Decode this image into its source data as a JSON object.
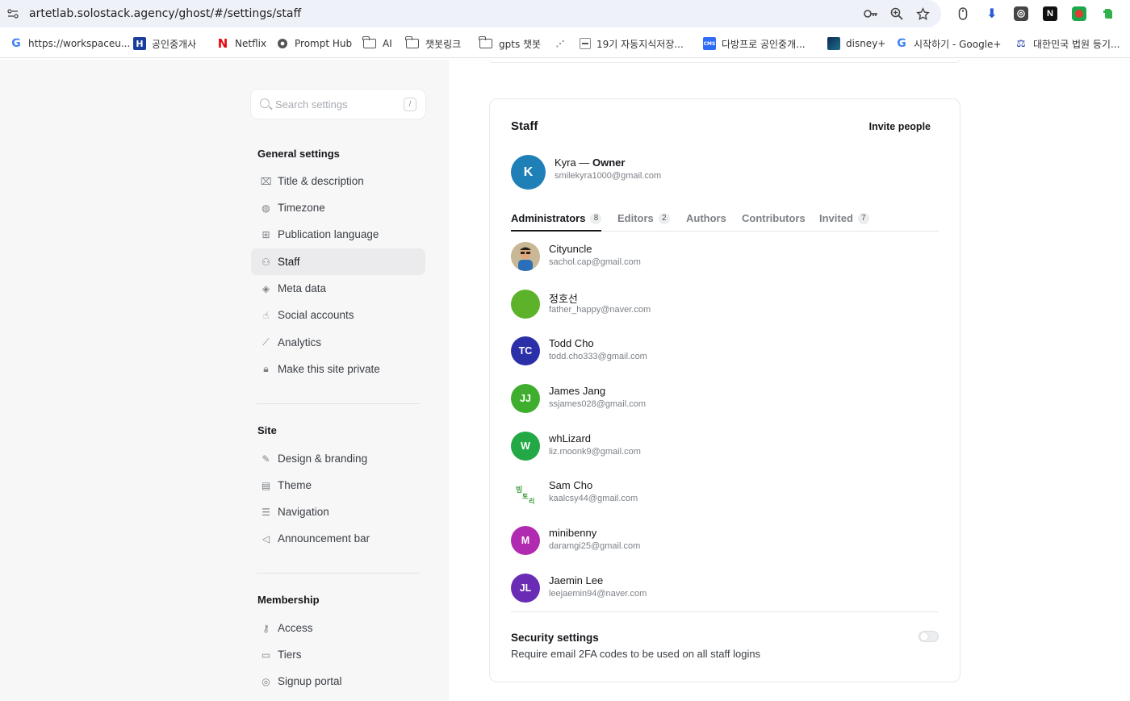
{
  "browser": {
    "url": "artetlab.solostack.agency/ghost/#/settings/staff",
    "bookmarks": [
      {
        "label": "https://workspaceu...",
        "icon": "google-icon"
      },
      {
        "label": "공인중개사",
        "icon": "h-icon"
      },
      {
        "label": "Netflix",
        "icon": "netflix-icon"
      },
      {
        "label": "Prompt Hub",
        "icon": "globe-icon"
      },
      {
        "label": "AI",
        "icon": "folder-icon"
      },
      {
        "label": "챗봇링크",
        "icon": "folder-icon"
      },
      {
        "label": "gpts 챗봇",
        "icon": "folder-icon"
      },
      {
        "label": "",
        "icon": "dot-icon"
      },
      {
        "label": "19기 자동지식저장...",
        "icon": "page-icon"
      },
      {
        "label": "다방프로 공인중개...",
        "icon": "dabang-icon"
      },
      {
        "label": "disney+",
        "icon": "disney-icon"
      },
      {
        "label": "시작하기 - Google+",
        "icon": "google-icon"
      },
      {
        "label": "대한민국 법원 등기...",
        "icon": "court-icon"
      }
    ]
  },
  "sidebar": {
    "search_placeholder": "Search settings",
    "search_shortcut": "/",
    "general_title": "General settings",
    "general_items": [
      "Title & description",
      "Timezone",
      "Publication language",
      "Staff",
      "Meta data",
      "Social accounts",
      "Analytics",
      "Make this site private"
    ],
    "site_title": "Site",
    "site_items": [
      "Design & branding",
      "Theme",
      "Navigation",
      "Announcement bar"
    ],
    "membership_title": "Membership",
    "membership_items": [
      "Access",
      "Tiers",
      "Signup portal"
    ]
  },
  "staff": {
    "title": "Staff",
    "invite_label": "Invite people",
    "owner": {
      "initial": "K",
      "name": "Kyra",
      "role": "Owner",
      "email": "smilekyra1000@gmail.com"
    },
    "tabs": [
      {
        "label": "Administrators",
        "count": "8"
      },
      {
        "label": "Editors",
        "count": "2"
      },
      {
        "label": "Authors",
        "count": ""
      },
      {
        "label": "Contributors",
        "count": ""
      },
      {
        "label": "Invited",
        "count": "7"
      }
    ],
    "users": [
      {
        "initials": "",
        "name": "Cityuncle",
        "email": "sachol.cap@gmail.com",
        "color": "#e8a060"
      },
      {
        "initials": "",
        "name": "정호선",
        "email": "father_happy@naver.com",
        "color": "#5cb32a"
      },
      {
        "initials": "TC",
        "name": "Todd Cho",
        "email": "todd.cho333@gmail.com",
        "color": "#2b2fa8"
      },
      {
        "initials": "JJ",
        "name": "James Jang",
        "email": "ssjames028@gmail.com",
        "color": "#3fae2e"
      },
      {
        "initials": "W",
        "name": "whLizard",
        "email": "liz.moonk9@gmail.com",
        "color": "#22a844"
      },
      {
        "initials": "",
        "name": "Sam Cho",
        "email": "kaalcsy44@gmail.com",
        "color": "#ffffff"
      },
      {
        "initials": "M",
        "name": "minibenny",
        "email": "daramgi25@gmail.com",
        "color": "#b02bb0"
      },
      {
        "initials": "JL",
        "name": "Jaemin Lee",
        "email": "leejaemin94@naver.com",
        "color": "#6a2cb5"
      }
    ],
    "security_title": "Security settings",
    "security_desc": "Require email 2FA codes to be used on all staff logins"
  }
}
